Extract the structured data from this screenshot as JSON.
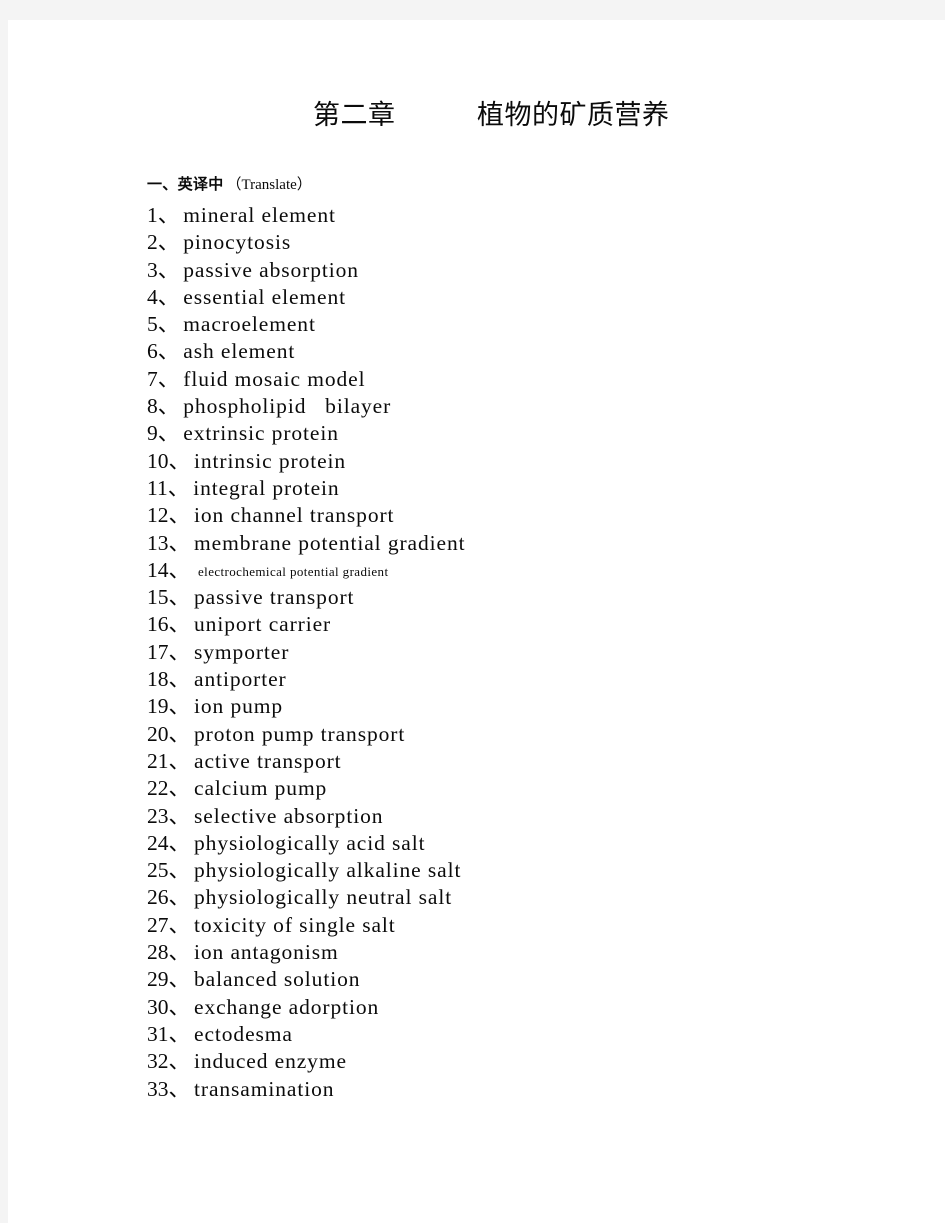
{
  "page": {
    "background_color": "#f4f4f4",
    "sheet_color": "#ffffff",
    "text_color": "#0b0b0b"
  },
  "title": {
    "chapter": "第二章",
    "subject": "植物的矿质营养"
  },
  "section": {
    "heading_cn": "一、英译中",
    "heading_en": "（Translate）"
  },
  "terms": [
    {
      "index": "1、",
      "text": "mineral element"
    },
    {
      "index": "2、",
      "text": "pinocytosis"
    },
    {
      "index": "3、",
      "text": "passive absorption"
    },
    {
      "index": "4、",
      "text": "essential element"
    },
    {
      "index": "5、",
      "text": "macroelement"
    },
    {
      "index": "6、",
      "text": "ash element"
    },
    {
      "index": "7、",
      "text": "fluid mosaic model"
    },
    {
      "index": "8、",
      "text": "phospholipid   bilayer"
    },
    {
      "index": "9、",
      "text": "extrinsic protein"
    },
    {
      "index": "10、",
      "text": "intrinsic protein"
    },
    {
      "index": "11、",
      "text": "integral protein"
    },
    {
      "index": "12、",
      "text": "ion channel transport"
    },
    {
      "index": "13、",
      "text": "membrane potential gradient"
    },
    {
      "index": "14、",
      "text": "electrochemical potential gradient"
    },
    {
      "index": "15、",
      "text": "passive transport"
    },
    {
      "index": "16、",
      "text": "uniport carrier"
    },
    {
      "index": "17、",
      "text": "symporter"
    },
    {
      "index": "18、",
      "text": "antiporter"
    },
    {
      "index": "19、",
      "text": "ion pump"
    },
    {
      "index": "20、",
      "text": "proton pump transport"
    },
    {
      "index": "21、",
      "text": "active transport"
    },
    {
      "index": "22、",
      "text": "calcium pump"
    },
    {
      "index": "23、",
      "text": "selective absorption"
    },
    {
      "index": "24、",
      "text": "physiologically acid salt"
    },
    {
      "index": "25、",
      "text": "physiologically alkaline salt"
    },
    {
      "index": "26、",
      "text": "physiologically neutral salt"
    },
    {
      "index": "27、",
      "text": "toxicity of single salt"
    },
    {
      "index": "28、",
      "text": "ion antagonism"
    },
    {
      "index": "29、",
      "text": "balanced solution"
    },
    {
      "index": "30、",
      "text": "exchange adorption"
    },
    {
      "index": "31、",
      "text": "ectodesma"
    },
    {
      "index": "32、",
      "text": "induced enzyme"
    },
    {
      "index": "33、",
      "text": "transamination"
    }
  ]
}
